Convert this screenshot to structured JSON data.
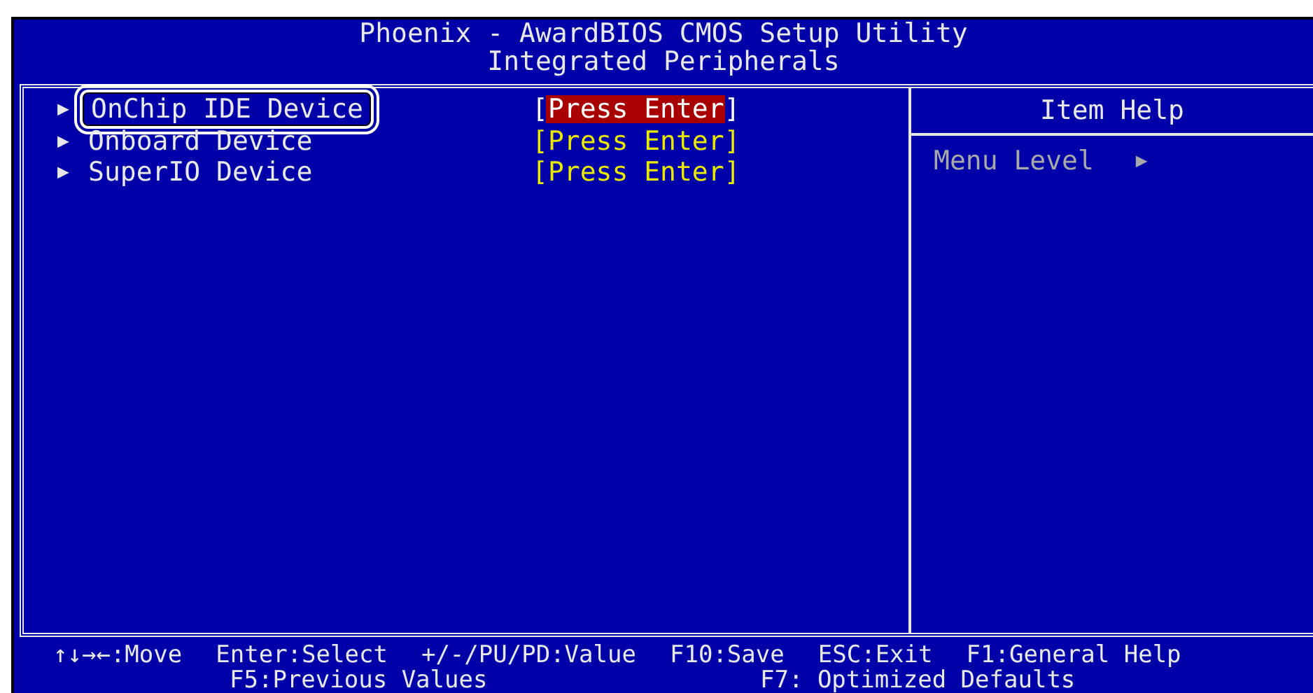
{
  "header": {
    "title": "Phoenix - AwardBIOS CMOS Setup Utility",
    "subtitle": "Integrated Peripherals"
  },
  "items": [
    {
      "label": "OnChip IDE Device",
      "value": "[Press Enter]",
      "selected": true,
      "marker": "▶"
    },
    {
      "label": "Onboard Device",
      "value": "[Press Enter]",
      "selected": false,
      "marker": "▶"
    },
    {
      "label": "SuperIO Device",
      "value": "[Press Enter]",
      "selected": false,
      "marker": "▶"
    }
  ],
  "help": {
    "title": "Item Help",
    "menu_level": "Menu Level",
    "menu_level_marker": "▶"
  },
  "footer": {
    "line_1": [
      "↑↓→←:Move",
      "Enter:Select",
      "+/-/PU/PD:Value",
      "F10:Save",
      "ESC:Exit",
      "F1:General Help"
    ],
    "line_2": [
      "F5:Previous Values",
      "F7: Optimized Defaults"
    ]
  }
}
